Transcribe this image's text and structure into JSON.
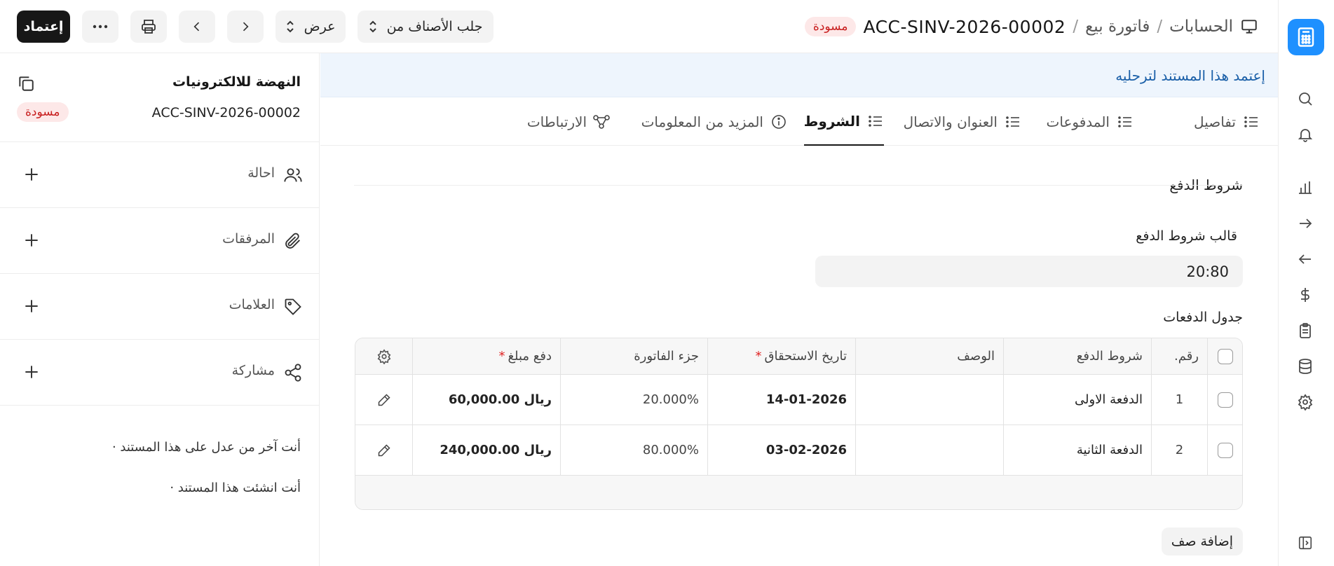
{
  "colors": {
    "accent": "#1e90ff",
    "draft_bg": "#fde8e8",
    "draft_text": "#c81e1e",
    "banner_bg": "#eef5fd",
    "banner_text": "#1a5fa8"
  },
  "header": {
    "breadcrumb": [
      "الحسابات",
      "فاتورة بيع"
    ],
    "doc_id": "ACC-SINV-2026-00002",
    "status": "مسودة",
    "buttons": {
      "submit": "إعتماد",
      "fetch_items": "جلب الأصناف من",
      "view": "عرض"
    }
  },
  "sidebar": {
    "company": "النهضة للالكترونيات",
    "doc_id": "ACC-SINV-2026-00002",
    "status": "مسودة",
    "items": [
      {
        "label": "احالة",
        "icon": "users-icon"
      },
      {
        "label": "المرفقات",
        "icon": "paperclip-icon"
      },
      {
        "label": "العلامات",
        "icon": "tag-icon"
      },
      {
        "label": "مشاركة",
        "icon": "share-icon"
      }
    ],
    "activity": [
      "أنت آخر من عدل على هذا المستند ·",
      "أنت انشئت هذا المستند ·"
    ]
  },
  "banner": "إعتمد هذا المستند لترحليه",
  "tabs": [
    {
      "label": "تفاصيل"
    },
    {
      "label": "المدفوعات"
    },
    {
      "label": "العنوان والاتصال"
    },
    {
      "label": "الشروط"
    },
    {
      "label": "المزيد من المعلومات"
    },
    {
      "label": "الارتباطات"
    }
  ],
  "terms": {
    "section_title": "شروط الدفع",
    "template_label": "قالب شروط الدفع",
    "template_value": "20:80",
    "schedule_title": "جدول الدفعات",
    "columns": {
      "no": "رقم.",
      "payment_term": "شروط الدفع",
      "description": "الوصف",
      "due_date": "تاريخ الاستحقاق",
      "invoice_portion": "جزء الفاتورة",
      "payment_amount": "دفع مبلغ"
    },
    "rows": [
      {
        "no": "1",
        "payment_term": "الدفعة الاولى",
        "description": "",
        "due_date": "14-01-2026",
        "invoice_portion": "20.000%",
        "payment_amount": "ريال 60,000.00"
      },
      {
        "no": "2",
        "payment_term": "الدفعة الثانية",
        "description": "",
        "due_date": "03-02-2026",
        "invoice_portion": "80.000%",
        "payment_amount": "ريال 240,000.00"
      }
    ],
    "add_row": "إضافة صف"
  }
}
